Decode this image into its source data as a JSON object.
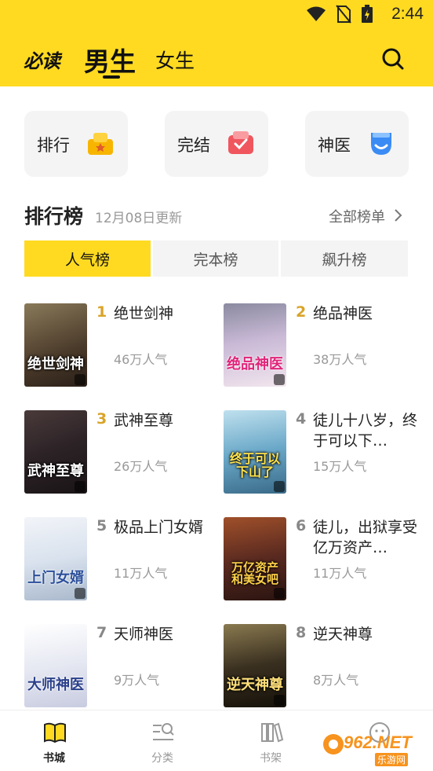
{
  "status_bar": {
    "time": "2:44"
  },
  "header": {
    "logo": "必读",
    "tabs": [
      {
        "label": "男生",
        "active": true
      },
      {
        "label": "女生",
        "active": false
      }
    ],
    "icons": {
      "search": "search-icon"
    }
  },
  "categories": [
    {
      "label": "排行",
      "icon": "trophy-icon",
      "color": "#F7B500"
    },
    {
      "label": "完结",
      "icon": "finished-icon",
      "color": "#F0565E"
    },
    {
      "label": "神医",
      "icon": "doctor-icon",
      "color": "#3B8BF5"
    }
  ],
  "ranking": {
    "title": "排行榜",
    "updated": "12月08日更新",
    "all_link": "全部榜单",
    "tabs": [
      {
        "label": "人气榜",
        "active": true
      },
      {
        "label": "完本榜",
        "active": false
      },
      {
        "label": "飙升榜",
        "active": false
      }
    ],
    "books": [
      {
        "rank": "1",
        "title": "绝世剑神",
        "popularity": "46万人气",
        "cover_text": "绝世剑神",
        "cover_color": "#4a3a2a"
      },
      {
        "rank": "2",
        "title": "绝品神医",
        "popularity": "38万人气",
        "cover_text": "绝品神医",
        "cover_color": "#c9b9d6"
      },
      {
        "rank": "3",
        "title": "武神至尊",
        "popularity": "26万人气",
        "cover_text": "武神至尊",
        "cover_color": "#2b2226"
      },
      {
        "rank": "4",
        "title": "徒儿十八岁，终于可以下…",
        "popularity": "15万人气",
        "cover_text": "终于可以下山了",
        "cover_color": "#6aa8c8"
      },
      {
        "rank": "5",
        "title": "极品上门女婿",
        "popularity": "11万人气",
        "cover_text": "上门女婿",
        "cover_color": "#d9e2ee"
      },
      {
        "rank": "6",
        "title": "徒儿，出狱享受亿万资产…",
        "popularity": "11万人气",
        "cover_text": "万亿资产和美女吧",
        "cover_color": "#5a2a20"
      },
      {
        "rank": "7",
        "title": "天师神医",
        "popularity": "9万人气",
        "cover_text": "大师神医",
        "cover_color": "#e6e8f2"
      },
      {
        "rank": "8",
        "title": "逆天神尊",
        "popularity": "8万人气",
        "cover_text": "逆天神尊",
        "cover_color": "#3a3020"
      }
    ],
    "rank_colors": {
      "top3": "#D9A429",
      "rest": "#888888"
    }
  },
  "bottom_nav": [
    {
      "label": "书城",
      "icon": "book-open-icon",
      "active": true
    },
    {
      "label": "分类",
      "icon": "category-search-icon",
      "active": false
    },
    {
      "label": "书架",
      "icon": "bookshelf-icon",
      "active": false
    },
    {
      "label": "",
      "icon": "profile-icon",
      "active": false
    }
  ],
  "watermark": {
    "brand": "962.NET",
    "sub": "乐游网"
  },
  "colors": {
    "accent": "#FFDA21"
  }
}
